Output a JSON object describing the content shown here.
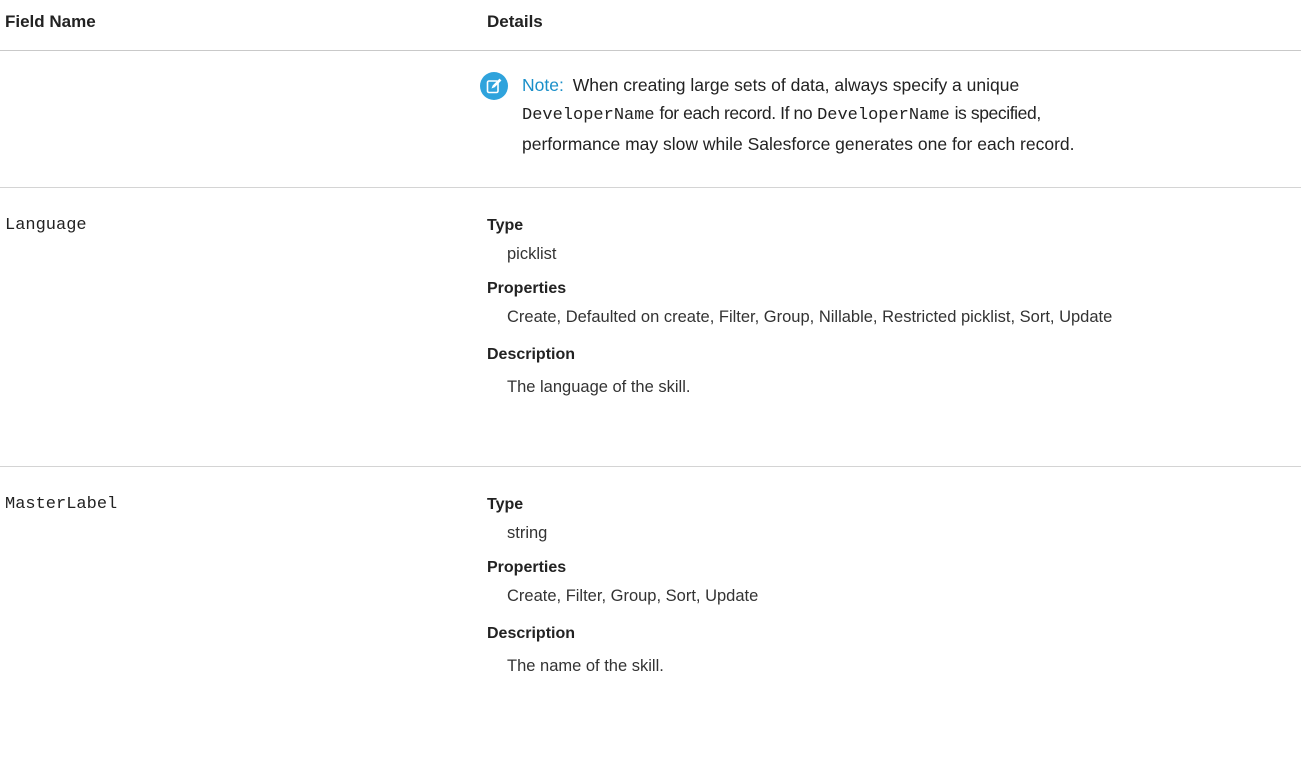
{
  "header": {
    "field_name": "Field Name",
    "details": "Details"
  },
  "note": {
    "label": "Note:",
    "text_1": "When creating large sets of data, always specify a unique",
    "code_1": "DeveloperName",
    "text_2": "for each record. If no",
    "code_2": "DeveloperName",
    "text_3": "is specified,",
    "text_4": "performance may slow while Salesforce generates one for each record.",
    "icon": "edit-note-icon"
  },
  "rows": [
    {
      "field": "Language",
      "type_label": "Type",
      "type": "picklist",
      "properties_label": "Properties",
      "properties": "Create, Defaulted on create, Filter, Group, Nillable, Restricted picklist, Sort, Update",
      "description_label": "Description",
      "description": "The language of the skill."
    },
    {
      "field": "MasterLabel",
      "type_label": "Type",
      "type": "string",
      "properties_label": "Properties",
      "properties": "Create, Filter, Group, Sort, Update",
      "description_label": "Description",
      "description": "The name of the skill."
    }
  ],
  "colors": {
    "note_accent": "#1a8fc9",
    "icon_bg": "#2fa3dc",
    "divider": "#d4d4d4"
  }
}
